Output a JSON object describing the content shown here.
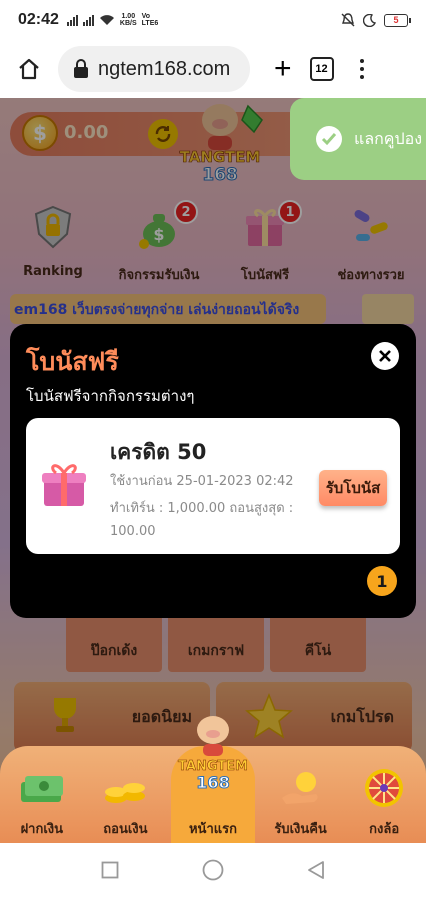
{
  "status_bar": {
    "time": "02:42",
    "net_speed_value": "1.00",
    "net_speed_unit": "KB/S",
    "volte_top": "Vo",
    "volte_bottom": "LTE6",
    "battery": "5"
  },
  "browser": {
    "url": "ngtem168.com",
    "tab_count": "12"
  },
  "site": {
    "balance": "0.00",
    "logo_text_top": "TANGTEM",
    "logo_text_bottom": "168",
    "toast_message": "แลกคูปอง",
    "menu": [
      {
        "label": "Ranking",
        "badge": ""
      },
      {
        "label": "กิจกรรมรับเงิน",
        "badge": "2"
      },
      {
        "label": "โบนัสฟรี",
        "badge": "1"
      },
      {
        "label": "ช่องทางรวย",
        "badge": ""
      }
    ],
    "marquee_text": "em168 เว็บตรงจ่ายทุกจ่าย เล่นง่ายถอนได้จริง",
    "games": [
      {
        "label": "ป๊อกเด้ง"
      },
      {
        "label": "เกมกราฟ"
      },
      {
        "label": "คีโน่"
      }
    ],
    "big_cards": [
      {
        "label": "ยอดนิยม"
      },
      {
        "label": "เกมโปรด"
      }
    ],
    "bottom_nav": [
      {
        "label": "ฝากเงิน"
      },
      {
        "label": "ถอนเงิน"
      },
      {
        "label": "หน้าแรก"
      },
      {
        "label": "รับเงินคืน"
      },
      {
        "label": "กงล้อ"
      }
    ]
  },
  "modal": {
    "title": "โบนัสฟรี",
    "subtitle": "โบนัสฟรีจากกิจกรรมต่างๆ",
    "card": {
      "title": "เครดิต 50",
      "expiry": "ใช้งานก่อน 25-01-2023 02:42",
      "turnover_line": "ทำเทิร์น : 1,000.00  ถอนสูงสุด :",
      "max_withdraw": "100.00",
      "claim_label": "รับโบนัส"
    },
    "page_number": "1"
  },
  "colors": {
    "accent": "#ff8c5a",
    "modal_bg": "#000000",
    "toast_bg": "#9ccf84",
    "pager": "#f7a51c"
  }
}
